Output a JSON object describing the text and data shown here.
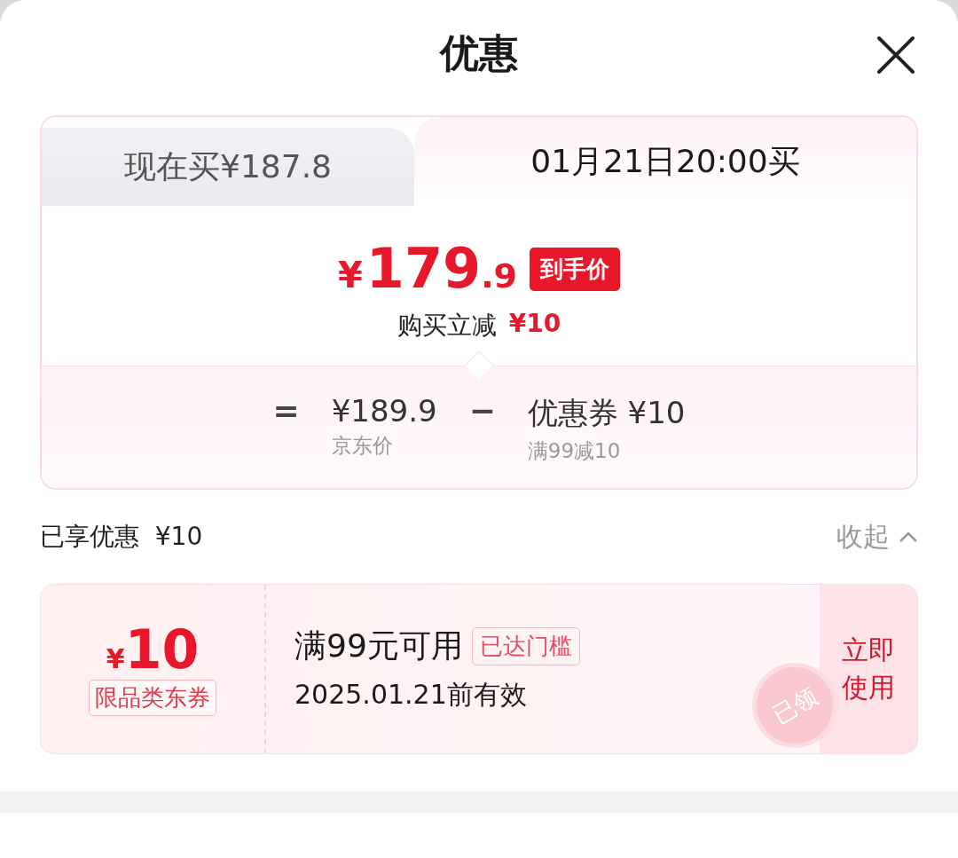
{
  "header": {
    "title": "优惠"
  },
  "tabs": [
    {
      "label": "现在买¥187.8",
      "selected": false
    },
    {
      "label": "01月21日20:00买",
      "selected": true
    }
  ],
  "price": {
    "currency": "¥",
    "integer": "179",
    "decimal": ".9",
    "badge": "到手价",
    "saving_label": "购买立减",
    "saving_value": "¥10"
  },
  "breakdown": [
    {
      "kind": "operator",
      "symbol": "="
    },
    {
      "kind": "term",
      "value": "¥189.9",
      "note": "京东价"
    },
    {
      "kind": "operator",
      "symbol": "−"
    },
    {
      "kind": "term",
      "value": "优惠券 ¥10",
      "note": "满99减10"
    }
  ],
  "summary": {
    "label": "已享优惠",
    "value": "¥10",
    "toggle": "收起",
    "expanded": true
  },
  "coupons": [
    {
      "currency": "¥",
      "amount": "10",
      "type": "限品类东券",
      "condition": "满99元可用",
      "tag": "已达门槛",
      "validity": "2025.01.21前有效",
      "action": "立即使用",
      "stamp": "已领"
    }
  ]
}
